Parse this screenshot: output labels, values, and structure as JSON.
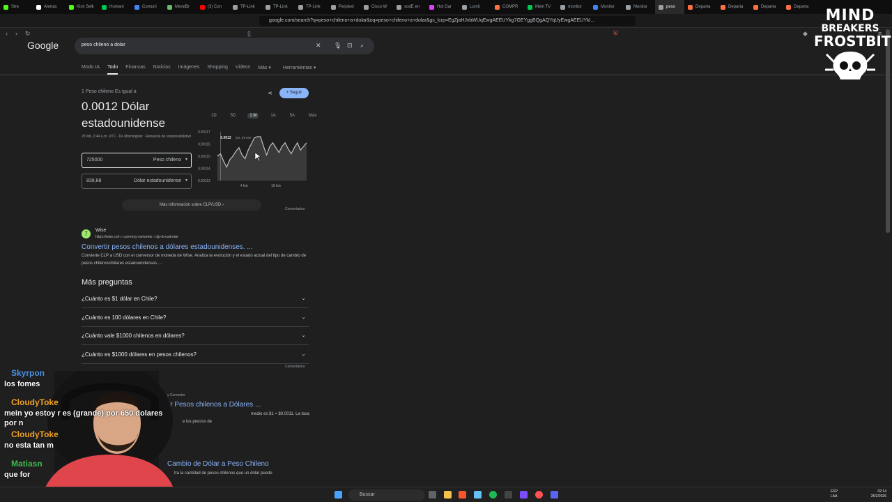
{
  "browser": {
    "tabs": [
      {
        "label": "Stre",
        "color": "#53fc18"
      },
      {
        "label": "Alertas",
        "color": "#ffffff"
      },
      {
        "label": "Kick Selk",
        "color": "#53fc18"
      },
      {
        "label": "Humani",
        "color": "#00c853"
      },
      {
        "label": "Comuni",
        "color": "#4285f4"
      },
      {
        "label": "MendBr",
        "color": "#66bb6a"
      },
      {
        "label": "(3) Con",
        "color": "#ff0000"
      },
      {
        "label": "TP-Link",
        "color": "#9aa0a6"
      },
      {
        "label": "TP-Link",
        "color": "#9aa0a6"
      },
      {
        "label": "TP-Link",
        "color": "#9aa0a6"
      },
      {
        "label": "Perplexi",
        "color": "#9aa0a6"
      },
      {
        "label": "Cisco W",
        "color": "#9aa0a6"
      },
      {
        "label": "sodE en",
        "color": "#9aa0a6"
      },
      {
        "label": "Hot Gar",
        "color": "#e040fb"
      },
      {
        "label": "Lumit",
        "color": "#9aa0a6"
      },
      {
        "label": "COMPR",
        "color": "#ff7043"
      },
      {
        "label": "Mein TV",
        "color": "#00c853"
      },
      {
        "label": "monitor",
        "color": "#9aa0a6"
      },
      {
        "label": "Monitor",
        "color": "#4285f4"
      },
      {
        "label": "Monitor",
        "color": "#9aa0a6"
      },
      {
        "label": "peso",
        "color": "#9aa0a6",
        "active": true
      },
      {
        "label": "Departa",
        "color": "#ff7043"
      },
      {
        "label": "Departa",
        "color": "#ff7043"
      },
      {
        "label": "Departa",
        "color": "#ff7043"
      },
      {
        "label": "Departa",
        "color": "#ff7043"
      }
    ],
    "url": "google.com/search?q=peso+chileno+a+dolar&oq=peso+chileno+a+dolar&gs_lcrp=EgZjaHJvbWUqEwgAEEUYkg7GEYggBQgAQYqUyEwgAEEUYkI..."
  },
  "google": {
    "logo": "Google",
    "query": "peso chileno a dolar",
    "filters": [
      "Modo IA",
      "Todo",
      "Finanzas",
      "Noticias",
      "Imágenes",
      "Shopping",
      "Videos",
      "Más ▾",
      "Herramientas ▾"
    ],
    "active_filter": "Todo"
  },
  "converter": {
    "equals_text": "1 Peso chileno Es igual a",
    "result": "0.0012 Dólar estadounidense",
    "meta": "25 feb, 2:44 a.m. UTC · De Morningstar · Renuncia de responsabilidad",
    "follow_label": "+ Seguir",
    "from_value": "725000",
    "from_currency": "Peso chileno",
    "to_value": "839,88",
    "to_currency": "Dólar estadounidense",
    "ranges": [
      "1D",
      "5D",
      "1 M",
      "1A",
      "5A",
      "Máx"
    ],
    "selected_range": "1 M",
    "more_info": "Más información sobre CLP/USD  ›",
    "feedback": "Comentarios"
  },
  "chart_data": {
    "type": "line",
    "y_ticks": [
      "0.00117",
      "0.00116",
      "0.00115",
      "0.00114",
      "0.00113"
    ],
    "ylim": [
      0.00113,
      0.00117
    ],
    "x_tick_labels": [
      "4 feb",
      "18 feb"
    ],
    "tooltip_value": "0.0012",
    "tooltip_date": "jue, 29 ene",
    "values": [
      0.00115,
      0.001152,
      0.001146,
      0.001141,
      0.001147,
      0.00115,
      0.001154,
      0.001157,
      0.001151,
      0.001148,
      0.001155,
      0.00116,
      0.001165,
      0.001166,
      0.001166,
      0.001158,
      0.001151,
      0.001158,
      0.001161,
      0.001157,
      0.001153,
      0.001158,
      0.001161,
      0.001156,
      0.001152,
      0.001157,
      0.001161,
      0.001155,
      0.001158,
      0.001161
    ],
    "color": "#bdc1c6"
  },
  "wise": {
    "badge": "7",
    "name": "Wise",
    "url": "https://wise.com › currency-converter › clp-to-usd-rate",
    "title": "Convertir pesos chilenos a dólares estadounidenses. ...",
    "snippet": "Convierte CLP a USD con el conversor de moneda de Wise. Analiza la evolución y el estado actual del tipo de cambio de pesos chilenos/dólares estadounidenses ..."
  },
  "paa": {
    "title": "Más preguntas",
    "questions": [
      "¿Cuánto es $1 dólar en Chile?",
      "¿Cuánto es 100 dólares en Chile?",
      "¿Cuánto vale $1000 chilenos en dólares?",
      "¿Cuánto es $1000 dólares en pesos chilenos?"
    ],
    "feedback": "Comentarios"
  },
  "results": [
    {
      "source": "y Converter",
      "title": "ir Pesos chilenos a Dólares ...",
      "snippet": "medio es $1 = $0.0011. La tasa",
      "snippet2": "e los precios de"
    },
    {
      "title": "Cambio de Dólar a Peso Chileno",
      "snippet": "tra la cantidad de pesos chilenos que un dólar puede"
    }
  ],
  "overlay": {
    "line1": "MIND",
    "line2": "BREAKERS",
    "line3": "FROSTBITE"
  },
  "chat": [
    {
      "user": "Skyrpon",
      "color": "#4a90e2",
      "msg": "los fomes"
    },
    {
      "user": "CloudyToke",
      "color": "#f0a020",
      "msg": "mein yo estoy r                    es (grande) por 650 dolares por n"
    },
    {
      "user": "CloudyToke",
      "color": "#f0a020",
      "msg": "no esta tan m"
    },
    {
      "user": "Matiasn",
      "color": "#3fb950",
      "msg": "que for"
    }
  ],
  "taskbar": {
    "search": "Buscar",
    "lang1": "ESP",
    "lang2": "LAA",
    "time": "02:14",
    "date": "25/2/2026"
  }
}
